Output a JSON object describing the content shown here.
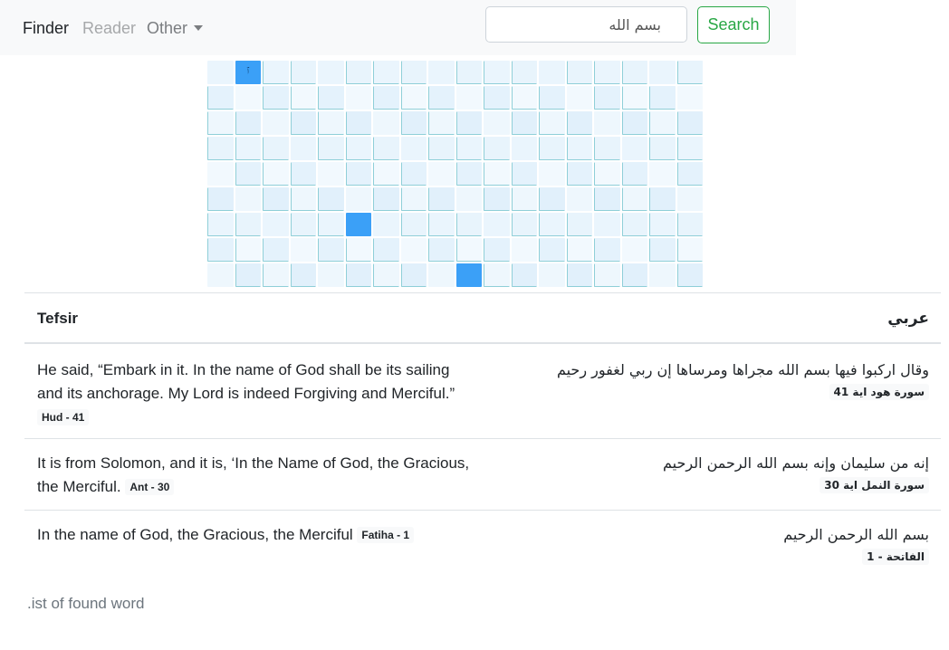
{
  "nav": {
    "finder": "Finder",
    "reader": "Reader",
    "other": "Other"
  },
  "search": {
    "value": "بسم الله",
    "button_label": "Search"
  },
  "grid": {
    "rows": 9,
    "cols": 18,
    "highlighted": [
      {
        "row": 0,
        "col": 1,
        "mark": "ﭐ"
      },
      {
        "row": 6,
        "col": 5,
        "mark": ""
      },
      {
        "row": 8,
        "col": 9,
        "mark": ""
      }
    ],
    "colors": {
      "highlight": "#3ba0f7",
      "cell_light": "#eaf5fd",
      "border": "#8fcfd8"
    }
  },
  "table": {
    "header_tefsir": "Tefsir",
    "header_arabic": "عربي",
    "rows": [
      {
        "english": "He said, “Embark in it. In the name of God shall be its sailing and its anchorage. My Lord is indeed Forgiving and Merciful.”",
        "english_ref": "Hud - 41",
        "arabic": "وقال اركبوا فيها بسم الله مجراها ومرساها إن ربي لغفور رحيم",
        "arabic_ref": "سورة هود اية 41"
      },
      {
        "english": "It is from Solomon, and it is, ‘In the Name of God, the Gracious, the Merciful.",
        "english_ref": "Ant - 30",
        "arabic": "إنه من سليمان وإنه بسم الله الرحمن الرحيم",
        "arabic_ref": "سورة النمل اية 30"
      },
      {
        "english": "In the name of God, the Gracious, the Merciful",
        "english_ref": "Fatiha - 1",
        "arabic": "بسم الله الرحمن الرحيم",
        "arabic_ref": "الفاتحة - 1"
      }
    ]
  },
  "footer": {
    "text": ".ist of found word"
  }
}
